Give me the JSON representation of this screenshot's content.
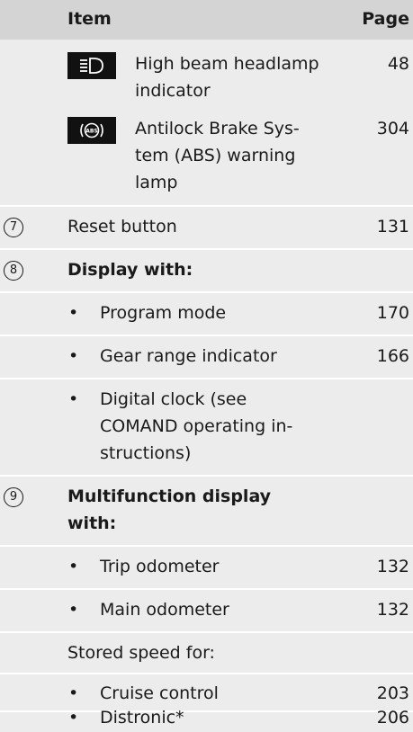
{
  "header": {
    "item": "Item",
    "page": "Page"
  },
  "rows": {
    "high_beam": {
      "label_1": "High beam headlamp",
      "label_2": "indicator",
      "page": "48",
      "icon": "high-beam-icon"
    },
    "abs": {
      "label_1": "Antilock Brake Sys-",
      "label_2": "tem (ABS) warning",
      "label_3": "lamp",
      "page": "304",
      "icon": "abs-icon"
    },
    "reset": {
      "num": "7",
      "label": "Reset button",
      "page": "131"
    },
    "display": {
      "num": "8",
      "label": "Display with:"
    },
    "program_mode": {
      "bullet": "•",
      "label": "Program mode",
      "page": "170"
    },
    "gear_range": {
      "bullet": "•",
      "label": "Gear range indicator",
      "page": "166"
    },
    "digital_clock": {
      "bullet": "•",
      "label_1": "Digital clock (see",
      "label_2": "COMAND operating in-",
      "label_3": "structions)"
    },
    "multifunction": {
      "num": "9",
      "label_1": "Multifunction display",
      "label_2": "with:"
    },
    "trip_odometer": {
      "bullet": "•",
      "label": "Trip odometer",
      "page": "132"
    },
    "main_odometer": {
      "bullet": "•",
      "label": "Main odometer",
      "page": "132"
    },
    "stored_speed": {
      "label": "Stored speed for:"
    },
    "cruise_control": {
      "bullet": "•",
      "label": "Cruise control",
      "page": "203"
    },
    "distronic": {
      "bullet": "•",
      "label": "Distronic*",
      "page": "206"
    }
  }
}
